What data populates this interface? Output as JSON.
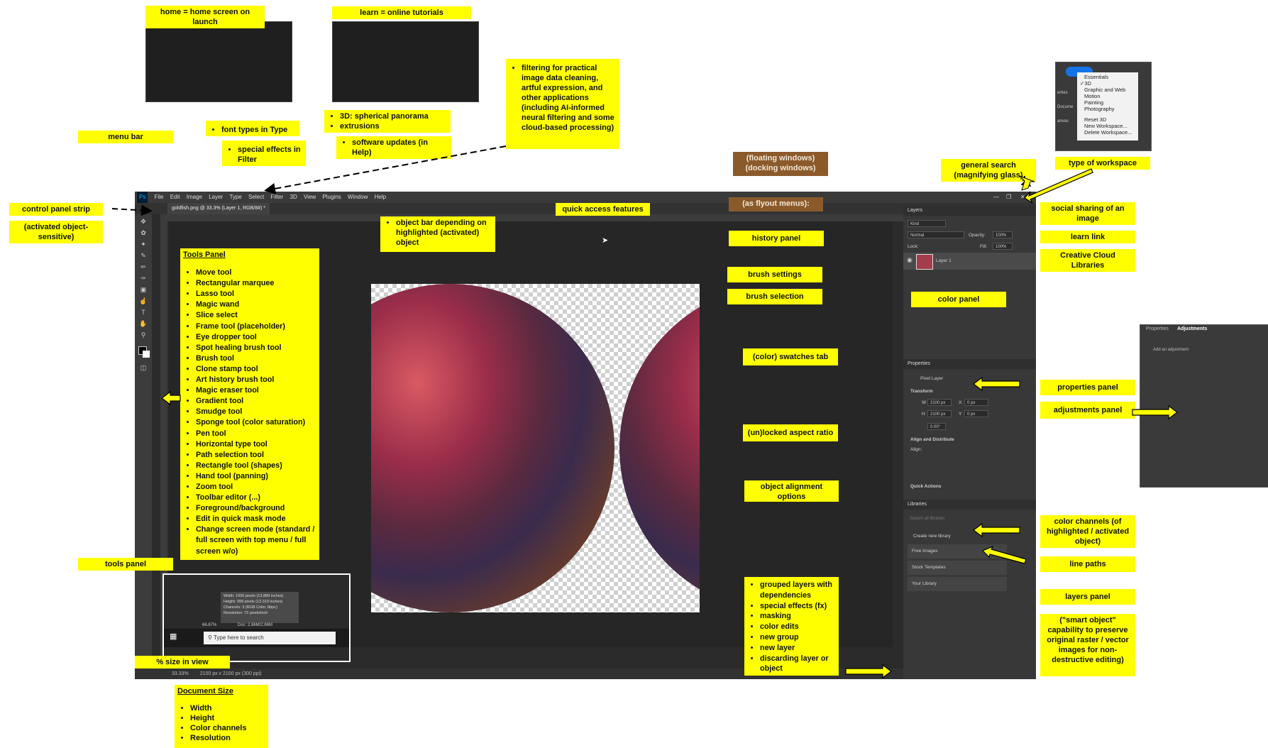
{
  "colors": {
    "note_bg": "#ffff00",
    "brown_note_bg": "#8b5a2b",
    "ps_bg": "#2b2b2b",
    "accent_blue": "#1473e6"
  },
  "menu": {
    "logo": "Ps",
    "items": [
      "File",
      "Edit",
      "Image",
      "Layer",
      "Type",
      "Select",
      "Filter",
      "3D",
      "View",
      "Plugins",
      "Window",
      "Help"
    ]
  },
  "doc_tab": "goldfish.png @ 33.3% (Layer 1, RGB/8#) *",
  "status": {
    "zoom": "33.33%",
    "doc_size": "2100 px x 2100 px (300 ppi)"
  },
  "panels": {
    "layers": {
      "title": "Layers",
      "kind": "Kind",
      "blend": "Normal",
      "opacity_label": "Opacity:",
      "opacity": "100%",
      "lock_label": "Lock:",
      "fill_label": "Fill:",
      "fill": "100%",
      "layer_name": "Layer 1"
    },
    "properties": {
      "title": "Properties",
      "pixel_layer": "Pixel Layer",
      "transform": "Transform",
      "w_label": "W",
      "w_value": "2100 px",
      "h_label": "H",
      "h_value": "2100 px",
      "x_label": "X",
      "x_value": "0 px",
      "y_label": "Y",
      "y_value": "0 px",
      "angle": "0.00°",
      "align": "Align and Distribute",
      "align_sub": "Align:",
      "quick": "Quick Actions"
    },
    "libraries": {
      "title": "Libraries",
      "search": "Search all libraries",
      "create": "Create new library",
      "items": [
        "Free Images",
        "Stock Templates",
        "Your Library"
      ]
    }
  },
  "workspace_menu": {
    "items": [
      "Essentials",
      "3D",
      "Graphic and Web",
      "Motion",
      "Painting",
      "Photography"
    ],
    "checked": "3D",
    "items2": [
      "Reset 3D",
      "New Workspace...",
      "Delete Workspace..."
    ],
    "side": [
      "erties",
      "Docume",
      "anvas"
    ]
  },
  "adjustments_inset": {
    "tab1": "Properties",
    "tab2": "Adjustments",
    "add": "Add an adjustment"
  },
  "taskbar_inset": {
    "info": [
      "Width: 1000 pixels (13.889 inches)",
      "Height: 999 pixels (13.319 inches)",
      "Channels: 3 (RGB Color, 8bpc)",
      "Resolution: 72 pixels/inch"
    ],
    "zoom": "66.67%",
    "doc": "Doc: 2.86M/2.86M",
    "search": "Type here to search"
  },
  "notes": {
    "home": "home = home screen on launch",
    "learn": "learn = online tutorials",
    "menu_bar": "menu bar",
    "font_types": "font types in Type",
    "special_effects": "special effects in Filter",
    "threed": [
      "3D: spherical panorama",
      "extrusions"
    ],
    "updates": "software updates (in Help)",
    "filtering": "filtering for practical image data cleaning, artful expression, and other applications (including AI-informed neural filtering and some cloud-based processing)",
    "floating": "(floating windows)\n(docking windows)",
    "flyout": "(as flyout menus):",
    "general_search": "general search (magnifying glass)",
    "type_workspace": "type of workspace",
    "control_strip": "control panel strip",
    "activated": "(activated object-sensitive)",
    "quick_access": "quick access features",
    "object_bar": "object bar depending on highlighted (activated) object",
    "social": "social sharing of an image",
    "learn_link": "learn link",
    "cc_libraries": "Creative Cloud Libraries",
    "history": "history panel",
    "brush_settings": "brush settings",
    "brush_selection": "brush selection",
    "color_panel": "color panel",
    "swatches": "(color) swatches tab",
    "aspect": "(un)locked aspect ratio",
    "alignment": "object alignment options",
    "properties_panel": "properties panel",
    "adjustments_panel": "adjustments panel",
    "color_channels": "color channels (of highlighted / activated object)",
    "line_paths": "line paths",
    "layers_panel": "layers panel",
    "smart_object": "(\"smart object\" capability to preserve original raster / vector images for non-destructive editing)",
    "tools_panel_title": "Tools Panel",
    "tools": [
      "Move tool",
      "Rectangular marquee",
      "Lasso tool",
      "Magic wand",
      "Slice select",
      "Frame tool (placeholder)",
      "Eye dropper tool",
      "Spot healing brush tool",
      "Brush tool",
      "Clone stamp tool",
      "Art history brush tool",
      "Magic eraser tool",
      "Gradient tool",
      "Smudge tool",
      "Sponge tool (color saturation)",
      "Pen tool",
      "Horizontal type tool",
      "Path selection tool",
      "Rectangle tool (shapes)",
      "Hand tool (panning)",
      "Zoom tool",
      "Toolbar editor (...)",
      "Foreground/background",
      "Edit in quick mask mode",
      "Change screen mode (standard / full screen with top menu / full screen w/o)"
    ],
    "tools_panel": "tools panel",
    "pct_size": "% size in view",
    "layers_features": [
      "grouped layers with dependencies",
      "special effects (fx)",
      "masking",
      "color edits",
      "new group",
      "new layer",
      "discarding layer or object"
    ],
    "doc_size_title": "Document Size",
    "doc_size_items": [
      "Width",
      "Height",
      "Color channels",
      "Resolution"
    ]
  }
}
